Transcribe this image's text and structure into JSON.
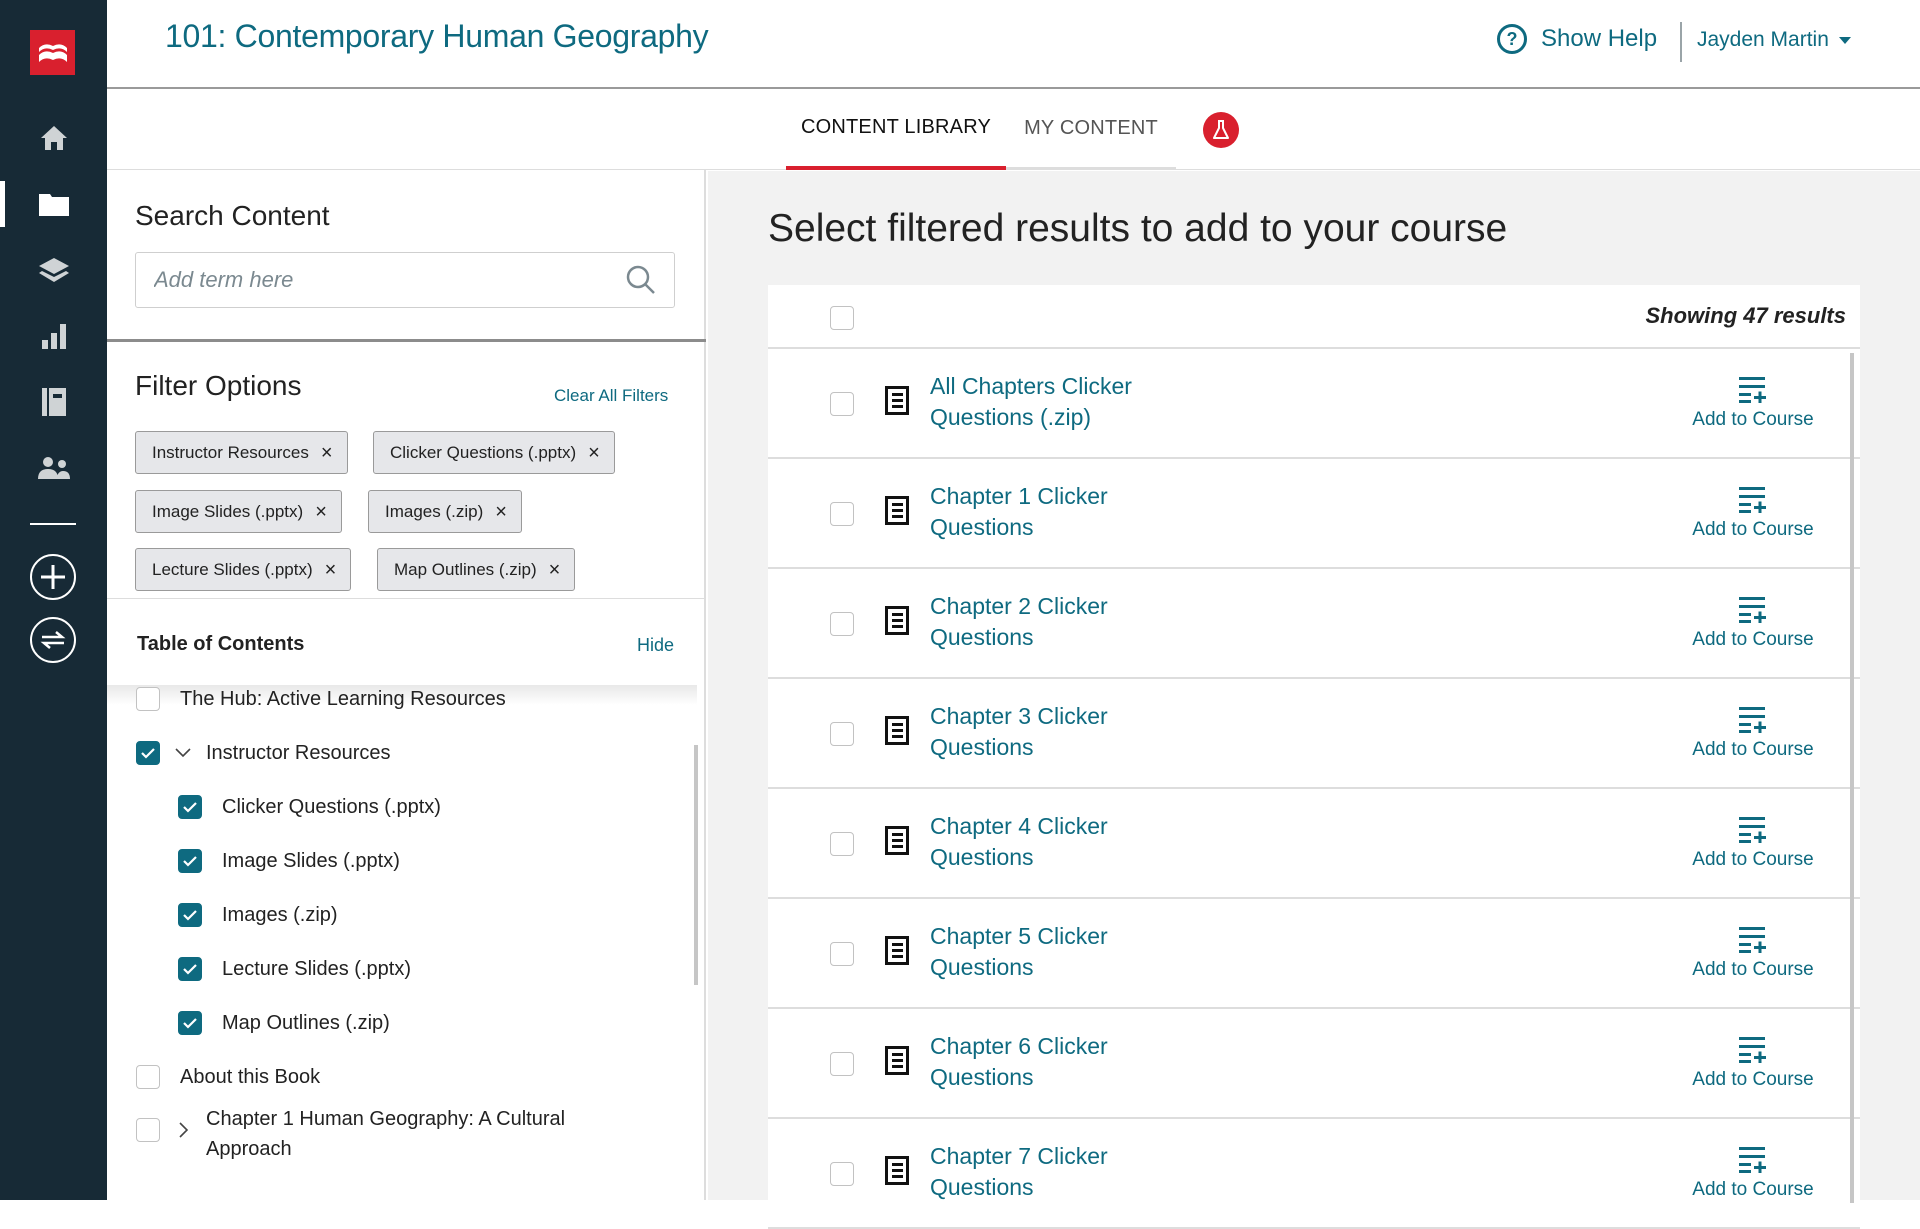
{
  "app": {
    "course_title": "101: Contemporary Human Geography",
    "help_label": "Show Help",
    "user_name": "Jayden Martin",
    "brand_color": "#d9202e",
    "accent_color": "#0e6a80"
  },
  "sidebar": {
    "items": [
      {
        "name": "home",
        "icon": "home-icon",
        "active": false
      },
      {
        "name": "content",
        "icon": "folder-icon",
        "active": true
      },
      {
        "name": "assignments",
        "icon": "layers-icon",
        "active": false
      },
      {
        "name": "gradebook",
        "icon": "bar-chart-icon",
        "active": false
      },
      {
        "name": "ebook",
        "icon": "notebook-icon",
        "active": false
      },
      {
        "name": "roster",
        "icon": "users-icon",
        "active": false
      }
    ],
    "actions": [
      {
        "name": "add",
        "icon": "plus-circle-icon"
      },
      {
        "name": "switch",
        "icon": "swap-circle-icon"
      }
    ]
  },
  "tabs": [
    {
      "label": "CONTENT LIBRARY",
      "active": true
    },
    {
      "label": "MY CONTENT",
      "active": false
    }
  ],
  "search": {
    "heading": "Search Content",
    "placeholder": "Add term here",
    "value": ""
  },
  "filters": {
    "heading": "Filter Options",
    "clear_label": "Clear All Filters",
    "chips": [
      "Instructor Resources",
      "Clicker Questions (.pptx)",
      "Image Slides (.pptx)",
      "Images (.zip)",
      "Lecture Slides (.pptx)",
      "Map Outlines (.zip)"
    ]
  },
  "toc": {
    "heading": "Table of Contents",
    "hide_label": "Hide",
    "items": [
      {
        "label": "The Hub: Active Learning Resources",
        "checked": false,
        "level": 0,
        "expander": "none"
      },
      {
        "label": "Instructor Resources",
        "checked": true,
        "level": 0,
        "expander": "expanded"
      },
      {
        "label": "Clicker Questions (.pptx)",
        "checked": true,
        "level": 1,
        "expander": "none"
      },
      {
        "label": "Image Slides (.pptx)",
        "checked": true,
        "level": 1,
        "expander": "none"
      },
      {
        "label": "Images (.zip)",
        "checked": true,
        "level": 1,
        "expander": "none"
      },
      {
        "label": "Lecture Slides (.pptx)",
        "checked": true,
        "level": 1,
        "expander": "none"
      },
      {
        "label": "Map Outlines (.zip)",
        "checked": true,
        "level": 1,
        "expander": "none"
      },
      {
        "label": "About this Book",
        "checked": false,
        "level": 0,
        "expander": "none"
      },
      {
        "label": "Chapter 1 Human Geography: A Cultural Approach",
        "checked": false,
        "level": 0,
        "expander": "collapsed"
      }
    ]
  },
  "results": {
    "heading": "Select filtered results to add to your course",
    "count_label": "Showing 47 results",
    "add_label": "Add to Course",
    "items": [
      "All Chapters Clicker Questions (.zip)",
      "Chapter 1 Clicker Questions",
      "Chapter 2 Clicker Questions",
      "Chapter 3 Clicker Questions",
      "Chapter 4 Clicker Questions",
      "Chapter 5 Clicker Questions",
      "Chapter 6 Clicker Questions",
      "Chapter 7 Clicker Questions"
    ]
  }
}
